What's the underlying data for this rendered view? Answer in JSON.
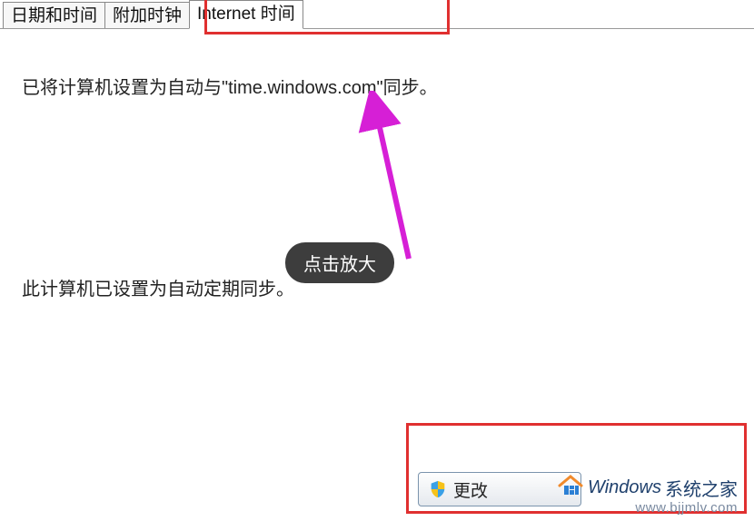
{
  "tabs": {
    "items": [
      {
        "label": "日期和时间"
      },
      {
        "label": "附加时钟"
      },
      {
        "label": "Internet 时间"
      }
    ]
  },
  "sync": {
    "status_line1": "已将计算机设置为自动与\"time.windows.com\"同步。",
    "status_line2": "此计算机已设置为自动定期同步。"
  },
  "tooltip": {
    "text": "点击放大"
  },
  "change_button": {
    "label": "更改"
  },
  "watermark": {
    "brand_en": "Windows",
    "brand_cn": "系统之家",
    "url": "www.bjjmlv.com"
  },
  "icons": {
    "shield": "shield-icon",
    "house": "house-icon"
  }
}
